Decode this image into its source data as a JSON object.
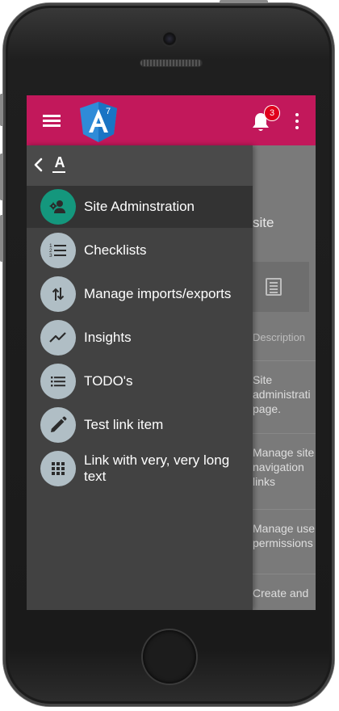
{
  "app": {
    "notification_count": "3",
    "accent_color": "#c2185b",
    "logo_text": "A",
    "logo_version": "7"
  },
  "drawer": {
    "header_icon": "text-format-icon",
    "header_letter": "A",
    "items": [
      {
        "label": "Site Adminstration",
        "icon": "admin-users-icon",
        "active": true
      },
      {
        "label": "Checklists",
        "icon": "numbered-list-icon",
        "active": false
      },
      {
        "label": "Manage imports/exports",
        "icon": "import-export-icon",
        "active": false
      },
      {
        "label": "Insights",
        "icon": "trending-chart-icon",
        "active": false
      },
      {
        "label": "TODO's",
        "icon": "list-icon",
        "active": false
      },
      {
        "label": "Test link item",
        "icon": "pencil-icon",
        "active": false
      },
      {
        "label": "Link with very, very long text",
        "icon": "apps-grid-icon",
        "active": false
      }
    ]
  },
  "background_page": {
    "title_fragment": "site",
    "column_header": "Description",
    "rows": [
      "Site\nadministrati\npage.",
      "Manage site\nnavigation\nlinks",
      "Manage use\npermissions",
      "Create and"
    ]
  }
}
